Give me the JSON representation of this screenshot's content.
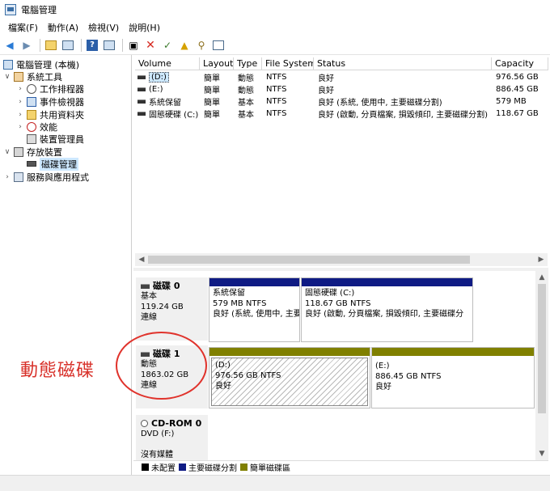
{
  "window": {
    "title": "電腦管理"
  },
  "menu": [
    "檔案(F)",
    "動作(A)",
    "檢視(V)",
    "說明(H)"
  ],
  "toolbar_icons": [
    "back-arrow-icon",
    "forward-arrow-icon",
    "up-folder-icon",
    "show-tree-icon",
    "help-icon",
    "pane-icon",
    "connect-icon",
    "delete-icon",
    "properties-icon",
    "export-icon",
    "search-icon",
    "view-icon"
  ],
  "tree": [
    {
      "label": "電腦管理 (本機)",
      "icon": "computer-icon",
      "expander": ""
    },
    {
      "label": "系統工具",
      "icon": "tools-icon",
      "expander": "expanded"
    },
    {
      "label": "工作排程器",
      "icon": "clock-icon",
      "expander": "collapsed"
    },
    {
      "label": "事件檢視器",
      "icon": "event-viewer-icon",
      "expander": "collapsed"
    },
    {
      "label": "共用資料夾",
      "icon": "shared-folder-icon",
      "expander": "collapsed"
    },
    {
      "label": "效能",
      "icon": "performance-icon",
      "expander": "collapsed"
    },
    {
      "label": "裝置管理員",
      "icon": "device-manager-icon",
      "expander": ""
    },
    {
      "label": "存放裝置",
      "icon": "storage-icon",
      "expander": "expanded"
    },
    {
      "label": "磁碟管理",
      "icon": "disk-icon",
      "expander": "",
      "selected": true
    },
    {
      "label": "服務與應用程式",
      "icon": "services-icon",
      "expander": "collapsed"
    }
  ],
  "volume_table": {
    "headers": [
      "Volume",
      "Layout",
      "Type",
      "File System",
      "Status",
      "Capacity"
    ],
    "rows": [
      [
        "(D:)",
        "簡單",
        "動態",
        "NTFS",
        "良好",
        "976.56 GB"
      ],
      [
        "(E:)",
        "簡單",
        "動態",
        "NTFS",
        "良好",
        "886.45 GB"
      ],
      [
        "系統保留",
        "簡單",
        "基本",
        "NTFS",
        "良好 (系統, 使用中, 主要磁碟分割)",
        "579 MB"
      ],
      [
        "固態硬碟 (C:)",
        "簡單",
        "基本",
        "NTFS",
        "良好 (啟動, 分頁檔案, 損毀傾印, 主要磁碟分割)",
        "118.67 GB"
      ]
    ]
  },
  "disks": [
    {
      "name": "磁碟 0",
      "type": "基本",
      "size": "119.24 GB",
      "state": "連線",
      "partitions": [
        {
          "name": "系統保留",
          "size_fs": "579 MB NTFS",
          "status": "良好 (系統, 使用中, 主要",
          "kind": "primary"
        },
        {
          "name": "固態硬碟 (C:)",
          "size_fs": "118.67 GB NTFS",
          "status": "良好 (啟動, 分頁檔案, 損毀傾印, 主要磁碟分",
          "kind": "primary"
        }
      ]
    },
    {
      "name": "磁碟 1",
      "type": "動態",
      "size": "1863.02 GB",
      "state": "連線",
      "partitions": [
        {
          "name": "(D:)",
          "size_fs": "976.56 GB NTFS",
          "status": "良好",
          "kind": "simple"
        },
        {
          "name": "(E:)",
          "size_fs": "886.45 GB NTFS",
          "status": "良好",
          "kind": "simple"
        }
      ]
    },
    {
      "name": "CD-ROM 0",
      "type": "DVD (F:)",
      "size": "",
      "state": "沒有媒體"
    }
  ],
  "legend": [
    {
      "label": "未配置",
      "color": "#000000"
    },
    {
      "label": "主要磁碟分割",
      "color": "#0f1b84"
    },
    {
      "label": "簡單磁碟區",
      "color": "#808000"
    }
  ],
  "annotation": {
    "text": "動態磁碟",
    "color": "#d8312a"
  }
}
